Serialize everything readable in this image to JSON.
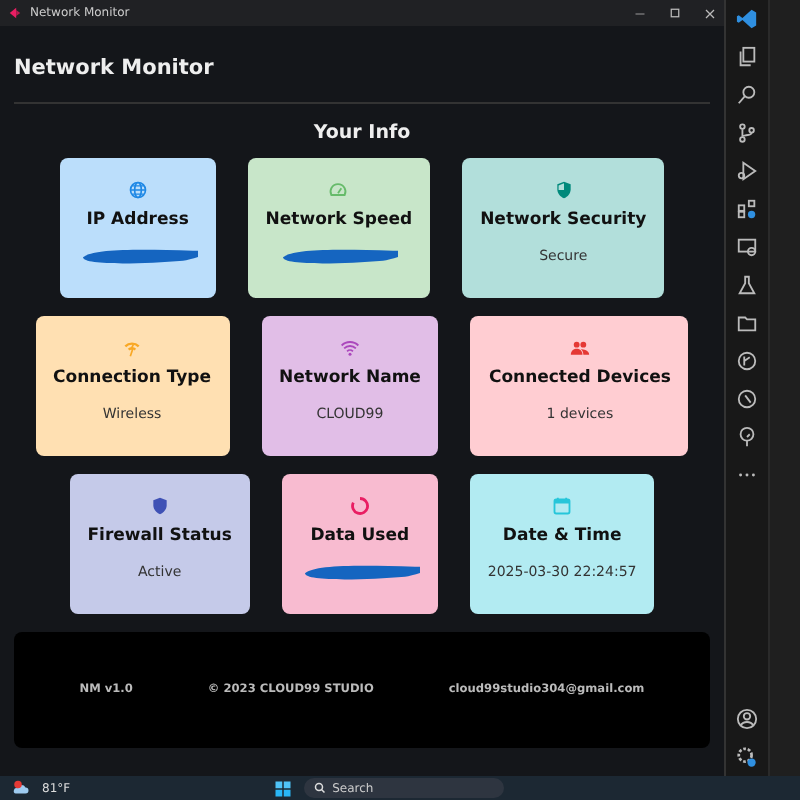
{
  "window": {
    "title": "Network Monitor"
  },
  "app": {
    "title": "Network Monitor",
    "section_title": "Your Info"
  },
  "card_rows": [
    [
      {
        "title": "IP Address",
        "redacted": true
      },
      {
        "title": "Network Speed",
        "redacted": true
      },
      {
        "title": "Network Security",
        "value": "Secure"
      }
    ],
    [
      {
        "title": "Connection Type",
        "value": "Wireless"
      },
      {
        "title": "Network Name",
        "value": "CLOUD99"
      },
      {
        "title": "Connected Devices",
        "value": "1 devices"
      }
    ],
    [
      {
        "title": "Firewall Status",
        "value": "Active"
      },
      {
        "title": "Data Used",
        "redacted": true
      },
      {
        "title": "Date & Time",
        "value": "2025-03-30 22:24:57"
      }
    ]
  ],
  "footer": [
    "NM v1.0",
    "© 2023 CLOUD99 STUDIO",
    "cloud99studio304@gmail.com"
  ],
  "taskbar": {
    "temperature": "81°F",
    "search_placeholder": "Search"
  }
}
